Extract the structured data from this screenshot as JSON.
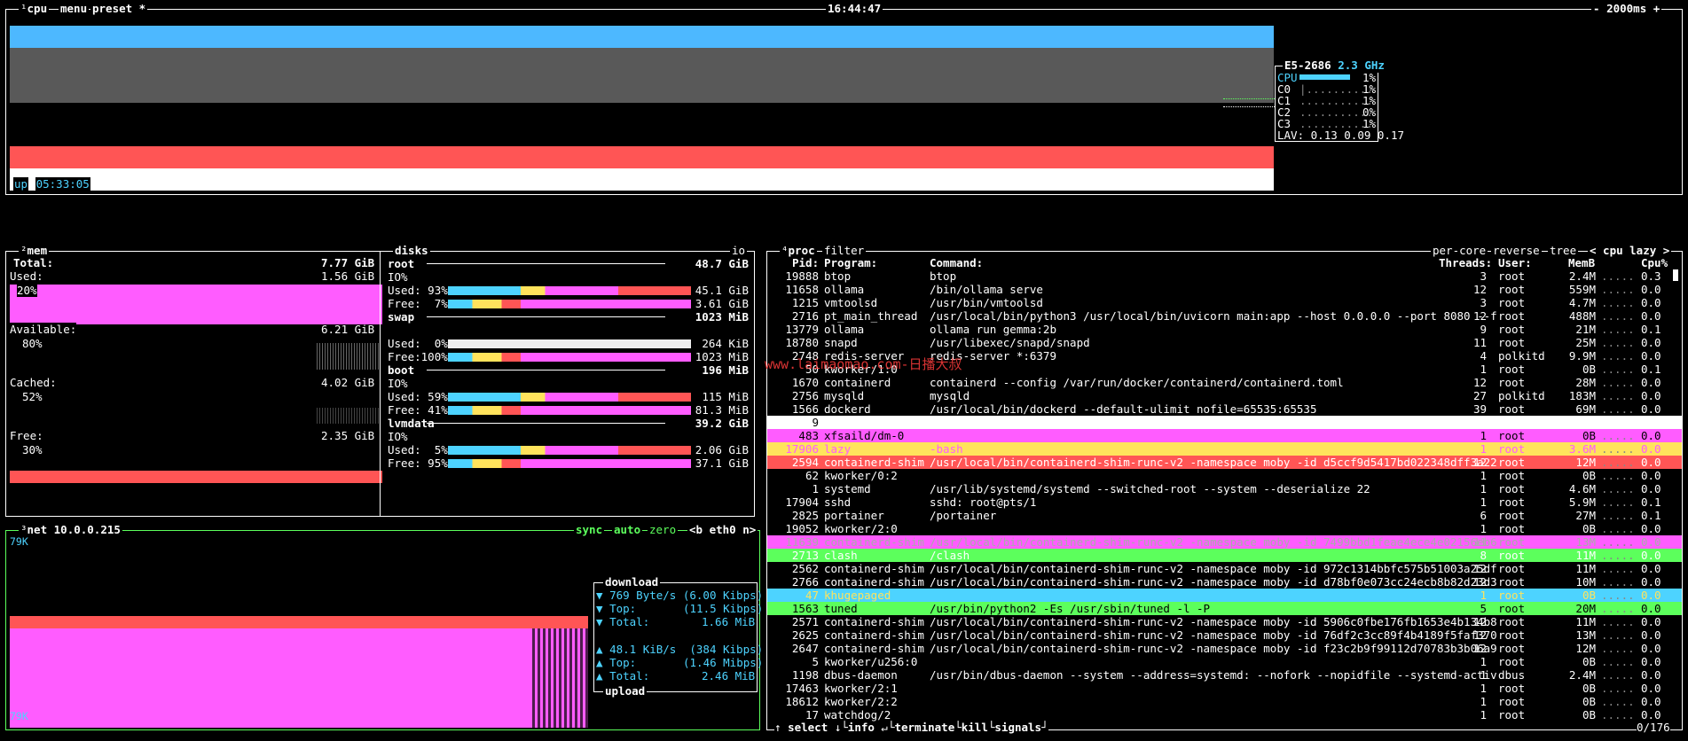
{
  "cpu_box": {
    "num": "¹",
    "title": "cpu",
    "menu": "menu",
    "preset": "preset *",
    "clock": "16:44:47",
    "interval_minus": "-",
    "interval": "2000ms",
    "interval_plus": "+",
    "uptime_label": "up",
    "uptime": "05:33:05",
    "cpu_model": "E5-2686",
    "freq": "2.3 GHz",
    "cores": [
      {
        "label": "CPU",
        "value": "1%"
      },
      {
        "label": "C0",
        "value": "1%"
      },
      {
        "label": "C1",
        "value": "1%"
      },
      {
        "label": "C2",
        "value": "0%"
      },
      {
        "label": "C3",
        "value": "1%"
      }
    ],
    "lav_label": "LAV:",
    "lav": "0.13 0.09 0.17",
    "colors": {
      "blue": "#4db8ff",
      "grey": "#595959",
      "red": "#ff5555",
      "white": "#ffffff"
    }
  },
  "mem_box": {
    "num": "²",
    "title": "mem",
    "total_label": "Total:",
    "total": "7.77 GiB",
    "used_label": "Used:",
    "used": "1.56 GiB",
    "used_pct": "20%",
    "available_label": "Available:",
    "available": "6.21 GiB",
    "available_pct": "80%",
    "cached_label": "Cached:",
    "cached": "4.02 GiB",
    "cached_pct": "52%",
    "free_label": "Free:",
    "free": "2.35 GiB",
    "free_pct": "30%"
  },
  "disks_box": {
    "title": "disks",
    "io": "io",
    "disks": [
      {
        "name": "root",
        "size": "48.7 GiB",
        "io": "IO%",
        "used_label": "Used:",
        "used_pct": " 93%",
        "used": "45.1 GiB",
        "free_label": "Free:",
        "free_pct": "  7%",
        "free": "3.61 GiB"
      },
      {
        "name": "swap",
        "size": "1023 MiB",
        "io": "",
        "used_label": "Used:",
        "used_pct": "  0%",
        "used": "264 KiB",
        "free_label": "Free:",
        "free_pct": "100%",
        "free": "1023 MiB"
      },
      {
        "name": "boot",
        "size": "196 MiB",
        "io": "IO%",
        "used_label": "Used:",
        "used_pct": " 59%",
        "used": "115 MiB",
        "free_label": "Free:",
        "free_pct": " 41%",
        "free": "81.3 MiB"
      },
      {
        "name": "lvmdata",
        "size": "39.2 GiB",
        "io": "IO%",
        "used_label": "Used:",
        "used_pct": "  5%",
        "used": "2.06 GiB",
        "free_label": "Free:",
        "free_pct": " 95%",
        "free": "37.1 GiB"
      }
    ]
  },
  "net_box": {
    "num": "³",
    "title": "net",
    "ip": "10.0.0.215",
    "sync": "sync",
    "auto": "auto",
    "zero": "zero",
    "iface": "<b eth0 n>",
    "scale_top": "79K",
    "scale_bottom": "79K",
    "download_title": "download",
    "download_rate": "769 Byte/s (6.00 Kibps)",
    "download_top_label": "Top:",
    "download_top": "(11.5 Kibps)",
    "download_total_label": "Total:",
    "download_total": "1.66 MiB",
    "upload_rate": "48.1 KiB/s  (384 Kibps)",
    "upload_top_label": "Top:",
    "upload_top": "(1.46 Mibps)",
    "upload_total_label": "Total:",
    "upload_total": "2.46 MiB",
    "upload_title": "upload"
  },
  "proc_box": {
    "num": "⁴",
    "title": "proc",
    "filter": "filter",
    "per_core": "per-core",
    "reverse": "reverse",
    "tree": "tree",
    "sort": "< cpu lazy >",
    "headers": {
      "pid": "Pid:",
      "program": "Program:",
      "command": "Command:",
      "threads": "Threads:",
      "user": "User:",
      "memb": "MemB",
      "cpu": "Cpu%"
    },
    "rows": [
      {
        "pid": "19888",
        "program": "btop",
        "command": "btop",
        "threads": "3",
        "user": "root",
        "mem": "2.4M",
        "cpu": "0.3"
      },
      {
        "pid": "11658",
        "program": "ollama",
        "command": "/bin/ollama serve",
        "threads": "12",
        "user": "root",
        "mem": "559M",
        "cpu": "0.0"
      },
      {
        "pid": "1215",
        "program": "vmtoolsd",
        "command": "/usr/bin/vmtoolsd",
        "threads": "3",
        "user": "root",
        "mem": "4.7M",
        "cpu": "0.0"
      },
      {
        "pid": "2716",
        "program": "pt_main_thread",
        "command": "/usr/local/bin/python3 /usr/local/bin/uvicorn main:app --host 0.0.0.0 --port 8080 --f",
        "threads": "12",
        "user": "root",
        "mem": "488M",
        "cpu": "0.0"
      },
      {
        "pid": "13779",
        "program": "ollama",
        "command": "ollama run gemma:2b",
        "threads": "9",
        "user": "root",
        "mem": "21M",
        "cpu": "0.1"
      },
      {
        "pid": "18780",
        "program": "snapd",
        "command": "/usr/libexec/snapd/snapd",
        "threads": "11",
        "user": "root",
        "mem": "25M",
        "cpu": "0.0"
      },
      {
        "pid": "2748",
        "program": "redis-server",
        "command": "redis-server *:6379",
        "threads": "4",
        "user": "polkitd",
        "mem": "9.9M",
        "cpu": "0.0"
      },
      {
        "pid": "50",
        "program": "kworker/1:0",
        "command": "",
        "threads": "1",
        "user": "root",
        "mem": "0B",
        "cpu": "0.1"
      },
      {
        "pid": "1670",
        "program": "containerd",
        "command": "containerd --config /var/run/docker/containerd/containerd.toml",
        "threads": "12",
        "user": "root",
        "mem": "28M",
        "cpu": "0.0"
      },
      {
        "pid": "2756",
        "program": "mysqld",
        "command": "mysqld",
        "threads": "27",
        "user": "polkitd",
        "mem": "183M",
        "cpu": "0.0"
      },
      {
        "pid": "1566",
        "program": "dockerd",
        "command": "/usr/local/bin/dockerd --default-ulimit nofile=65535:65535",
        "threads": "39",
        "user": "root",
        "mem": "69M",
        "cpu": "0.0"
      },
      {
        "pid": "9",
        "program": "",
        "command": "",
        "threads": "",
        "user": "",
        "mem": "",
        "cpu": ""
      },
      {
        "pid": "483",
        "program": "xfsaild/dm-0",
        "command": "",
        "threads": "1",
        "user": "root",
        "mem": "0B",
        "cpu": "0.0"
      },
      {
        "pid": "17906",
        "program": "lazy",
        "command": "-bash",
        "threads": "1",
        "user": "root",
        "mem": "3.6M",
        "cpu": "0.0"
      },
      {
        "pid": "2594",
        "program": "containerd-shim",
        "command": "/usr/local/bin/containerd-shim-runc-v2 -namespace moby -id d5ccf9d5417bd022348dff3a22",
        "threads": "12",
        "user": "root",
        "mem": "12M",
        "cpu": "0.0"
      },
      {
        "pid": "62",
        "program": "kworker/0:2",
        "command": "",
        "threads": "1",
        "user": "root",
        "mem": "0B",
        "cpu": "0.0"
      },
      {
        "pid": "1",
        "program": "systemd",
        "command": "/usr/lib/systemd/systemd --switched-root --system --deserialize 22",
        "threads": "1",
        "user": "root",
        "mem": "4.6M",
        "cpu": "0.0"
      },
      {
        "pid": "17904",
        "program": "sshd",
        "command": "sshd: root@pts/1",
        "threads": "1",
        "user": "root",
        "mem": "5.9M",
        "cpu": "0.1"
      },
      {
        "pid": "2825",
        "program": "portainer",
        "command": "/portainer",
        "threads": "6",
        "user": "root",
        "mem": "27M",
        "cpu": "0.1"
      },
      {
        "pid": "19052",
        "program": "kworker/2:0",
        "command": "",
        "threads": "1",
        "user": "root",
        "mem": "0B",
        "cpu": "0.0"
      },
      {
        "pid": "11639",
        "program": "containerd-shim",
        "command": "/usr/local/bin/containerd-shim-runc-v2 -namespace moby -id 7499bbd1feae4ece4e02156eb6",
        "threads": "11",
        "user": "root",
        "mem": "13M",
        "cpu": "0.0"
      },
      {
        "pid": "2713",
        "program": "clash",
        "command": "/clash",
        "threads": "8",
        "user": "root",
        "mem": "11M",
        "cpu": "0.0"
      },
      {
        "pid": "2562",
        "program": "containerd-shim",
        "command": "/usr/local/bin/containerd-shim-runc-v2 -namespace moby -id 972c1314bbfc575b51003a25df",
        "threads": "12",
        "user": "root",
        "mem": "11M",
        "cpu": "0.0"
      },
      {
        "pid": "2766",
        "program": "containerd-shim",
        "command": "/usr/local/bin/containerd-shim-runc-v2 -namespace moby -id d78bf0e073cc24ecb8b82d23d3",
        "threads": "12",
        "user": "root",
        "mem": "10M",
        "cpu": "0.0"
      },
      {
        "pid": "47",
        "program": "khugepaged",
        "command": "",
        "threads": "1",
        "user": "root",
        "mem": "0B",
        "cpu": "0.0"
      },
      {
        "pid": "1563",
        "program": "tuned",
        "command": "/usr/bin/python2 -Es /usr/sbin/tuned -l -P",
        "threads": "5",
        "user": "root",
        "mem": "20M",
        "cpu": "0.0"
      },
      {
        "pid": "2571",
        "program": "containerd-shim",
        "command": "/usr/local/bin/containerd-shim-runc-v2 -namespace moby -id 5906c0fbe176fb1653e4b134b8",
        "threads": "12",
        "user": "root",
        "mem": "11M",
        "cpu": "0.0"
      },
      {
        "pid": "2625",
        "program": "containerd-shim",
        "command": "/usr/local/bin/containerd-shim-runc-v2 -namespace moby -id 76df2c3cc89f4b4189f5faf370",
        "threads": "12",
        "user": "root",
        "mem": "13M",
        "cpu": "0.0"
      },
      {
        "pid": "2647",
        "program": "containerd-shim",
        "command": "/usr/local/bin/containerd-shim-runc-v2 -namespace moby -id f23c2b9f99112d70783b3b06a9",
        "threads": "12",
        "user": "root",
        "mem": "12M",
        "cpu": "0.0"
      },
      {
        "pid": "5",
        "program": "kworker/u256:0",
        "command": "",
        "threads": "1",
        "user": "root",
        "mem": "0B",
        "cpu": "0.0"
      },
      {
        "pid": "1198",
        "program": "dbus-daemon",
        "command": "/usr/bin/dbus-daemon --system --address=systemd: --nofork --nopidfile --systemd-activ",
        "threads": "1",
        "user": "dbus",
        "mem": "2.4M",
        "cpu": "0.0"
      },
      {
        "pid": "17463",
        "program": "kworker/2:1",
        "command": "",
        "threads": "1",
        "user": "root",
        "mem": "0B",
        "cpu": "0.0"
      },
      {
        "pid": "18612",
        "program": "kworker/2:2",
        "command": "",
        "threads": "1",
        "user": "root",
        "mem": "0B",
        "cpu": "0.0"
      },
      {
        "pid": "17",
        "program": "watchdog/2",
        "command": "",
        "threads": "1",
        "user": "root",
        "mem": "0B",
        "cpu": "0.0"
      }
    ],
    "footer": {
      "select": "select",
      "info": "info",
      "terminate": "terminate",
      "kill": "kill",
      "signals": "signals",
      "count": "0/176"
    }
  },
  "watermark": "www.laimaomao.com-日播大叔"
}
